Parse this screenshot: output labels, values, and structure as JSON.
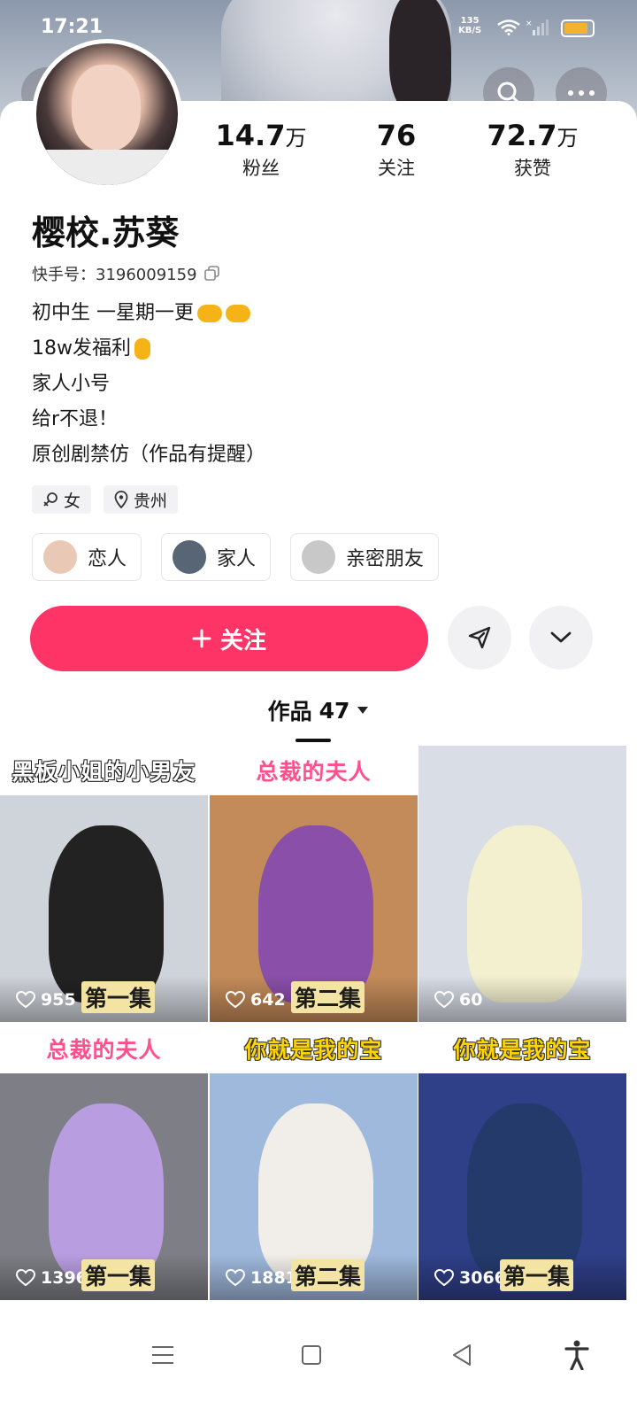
{
  "status_bar": {
    "time": "17:21",
    "speed_value": "135",
    "speed_unit": "KB/S",
    "battery_level": 0.85,
    "battery_color": "#f3b230"
  },
  "profile": {
    "name": "樱校.苏葵",
    "kuaishou_id": "快手号：3196009159",
    "stats": [
      {
        "value": "14.7",
        "unit": "万",
        "label": "粉丝"
      },
      {
        "value": "76",
        "unit": "",
        "label": "关注"
      },
      {
        "value": "72.7",
        "unit": "万",
        "label": "获赞"
      }
    ],
    "bio": [
      "初中生 一星期一更",
      "18w发福利",
      "家人小号",
      "给r不退！",
      "原创剧禁仿（作品有提醒）"
    ],
    "gender": "女",
    "location": "贵州",
    "relations": [
      {
        "label": "恋人",
        "avatar_color": "#e9c9b6"
      },
      {
        "label": "家人",
        "avatar_color": "#586574"
      },
      {
        "label": "亲密朋友",
        "avatar_color": "#c8c8c8"
      }
    ]
  },
  "actions": {
    "follow_label": "关注",
    "follow_color": "#fe3466"
  },
  "works_tab": {
    "label": "作品",
    "count": "47"
  },
  "videos": [
    {
      "title": "黑板小姐的小男友",
      "title_color": "#ffffff",
      "title_stroke": "#222222",
      "banner_bg": "#ffffff",
      "likes": "955",
      "episode": "第一集",
      "scene_color": "#cfd3da",
      "char_color": "#222222"
    },
    {
      "title": "总裁的夫人",
      "title_color": "#ff4f8e",
      "title_stroke": "#ffffff",
      "banner_bg": "#ffffff",
      "likes": "642",
      "episode": "第二集",
      "scene_color": "#c48b5a",
      "char_color": "#8a4fa8"
    },
    {
      "title": "",
      "title_color": "#ffffff",
      "title_stroke": "#ffffff",
      "banner_bg": "#e9eef5",
      "likes": "60",
      "episode": "",
      "scene_color": "#d8dde6",
      "char_color": "#f2f0ce"
    },
    {
      "title": "总裁的夫人",
      "title_color": "#ff4f8e",
      "title_stroke": "#ffffff",
      "banner_bg": "#ffffff",
      "likes": "1396",
      "episode": "第一集",
      "scene_color": "#7e7f86",
      "char_color": "#b89de0"
    },
    {
      "title": "你就是我的宝",
      "title_color": "#ffd400",
      "title_stroke": "#333333",
      "banner_bg": "#ffffff",
      "likes": "1881",
      "episode": "第二集",
      "scene_color": "#9fb9dd",
      "char_color": "#f1ede9"
    },
    {
      "title": "你就是我的宝",
      "title_color": "#ffd400",
      "title_stroke": "#333333",
      "banner_bg": "#ffffff",
      "likes": "3066",
      "episode": "第一集",
      "scene_color": "#2f3f88",
      "char_color": "#233a6b"
    }
  ],
  "nav": {
    "items": [
      "menu-icon",
      "home-icon",
      "back-icon",
      "accessibility-icon"
    ]
  }
}
